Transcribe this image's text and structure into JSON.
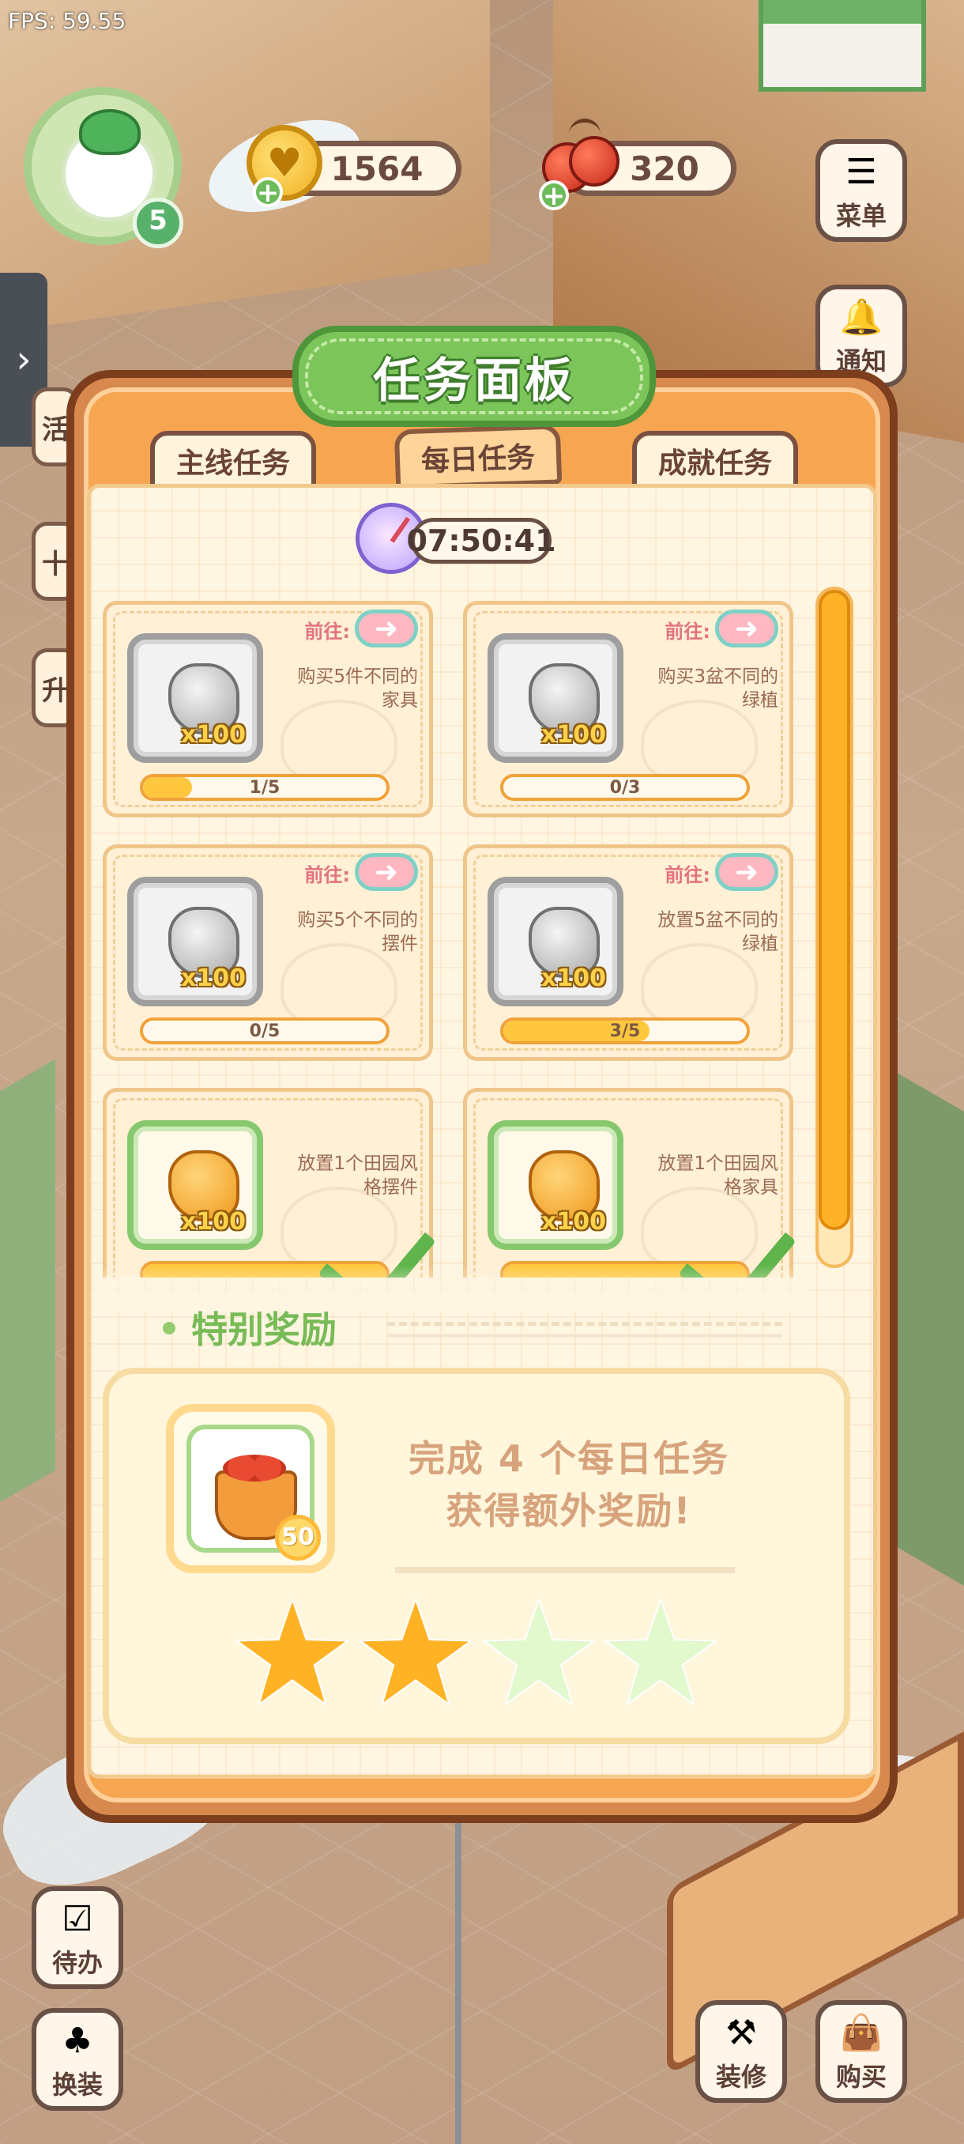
{
  "hud": {
    "fps": "FPS: 59.55",
    "level": "5",
    "coins": "1564",
    "cherries": "320",
    "plus_symbol": "+"
  },
  "side_buttons_right": [
    {
      "label": "菜单",
      "icon": "menu-icon"
    },
    {
      "label": "通知",
      "icon": "bell-icon"
    }
  ],
  "side_peek_left": [
    {
      "label": "活"
    },
    {
      "label": "十"
    },
    {
      "label": "升"
    }
  ],
  "bottom_buttons": [
    {
      "label": "待办",
      "icon": "checklist-icon"
    },
    {
      "label": "换装",
      "icon": "outfit-icon"
    },
    {
      "label": "装修",
      "icon": "renovate-icon"
    },
    {
      "label": "购买",
      "icon": "shopping-bag-icon"
    }
  ],
  "panel": {
    "title": "任务面板",
    "tabs": [
      "主线任务",
      "每日任务",
      "成就任务"
    ],
    "active_tab": "每日任务",
    "timer": "07:50:41"
  },
  "tasks": [
    {
      "desc_line1": "购买5件不同的",
      "desc_line2": "家具",
      "reward_qty": "x100",
      "progress_text": "1/5",
      "progress": 0.2,
      "goto": "前往:",
      "reward_type": "gray",
      "status": "in-progress"
    },
    {
      "desc_line1": "购买3盆不同的",
      "desc_line2": "绿植",
      "reward_qty": "x100",
      "progress_text": "0/3",
      "progress": 0,
      "goto": "前往:",
      "reward_type": "gray",
      "status": "in-progress"
    },
    {
      "desc_line1": "购买5个不同的",
      "desc_line2": "摆件",
      "reward_qty": "x100",
      "progress_text": "0/5",
      "progress": 0,
      "goto": "前往:",
      "reward_type": "gray",
      "status": "in-progress"
    },
    {
      "desc_line1": "放置5盆不同的",
      "desc_line2": "绿植",
      "reward_qty": "x100",
      "progress_text": "3/5",
      "progress": 0.6,
      "goto": "前往:",
      "reward_type": "gray",
      "status": "in-progress"
    },
    {
      "desc_line1": "放置1个田园风",
      "desc_line2": "格摆件",
      "reward_qty": "x100",
      "progress_text": "",
      "progress": 1,
      "goto": "",
      "reward_type": "green",
      "status": "completed"
    },
    {
      "desc_line1": "放置1个田园风",
      "desc_line2": "格家具",
      "reward_qty": "x100",
      "progress_text": "",
      "progress": 1,
      "goto": "",
      "reward_type": "green",
      "status": "completed"
    }
  ],
  "special": {
    "title": "特别奖励",
    "text_line1": "完成 4 个每日任务",
    "text_line2": "获得额外奖励!",
    "reward_count": "50",
    "stars_total": 4,
    "stars_filled": 2
  },
  "colors": {
    "panel_border": "#7c3e1d",
    "panel_orange": "#f6a551",
    "title_green": "#7cc55a",
    "progress_fill": "#ffc73d",
    "star_on": "#ffb324",
    "star_off": "#e2f8cd"
  }
}
